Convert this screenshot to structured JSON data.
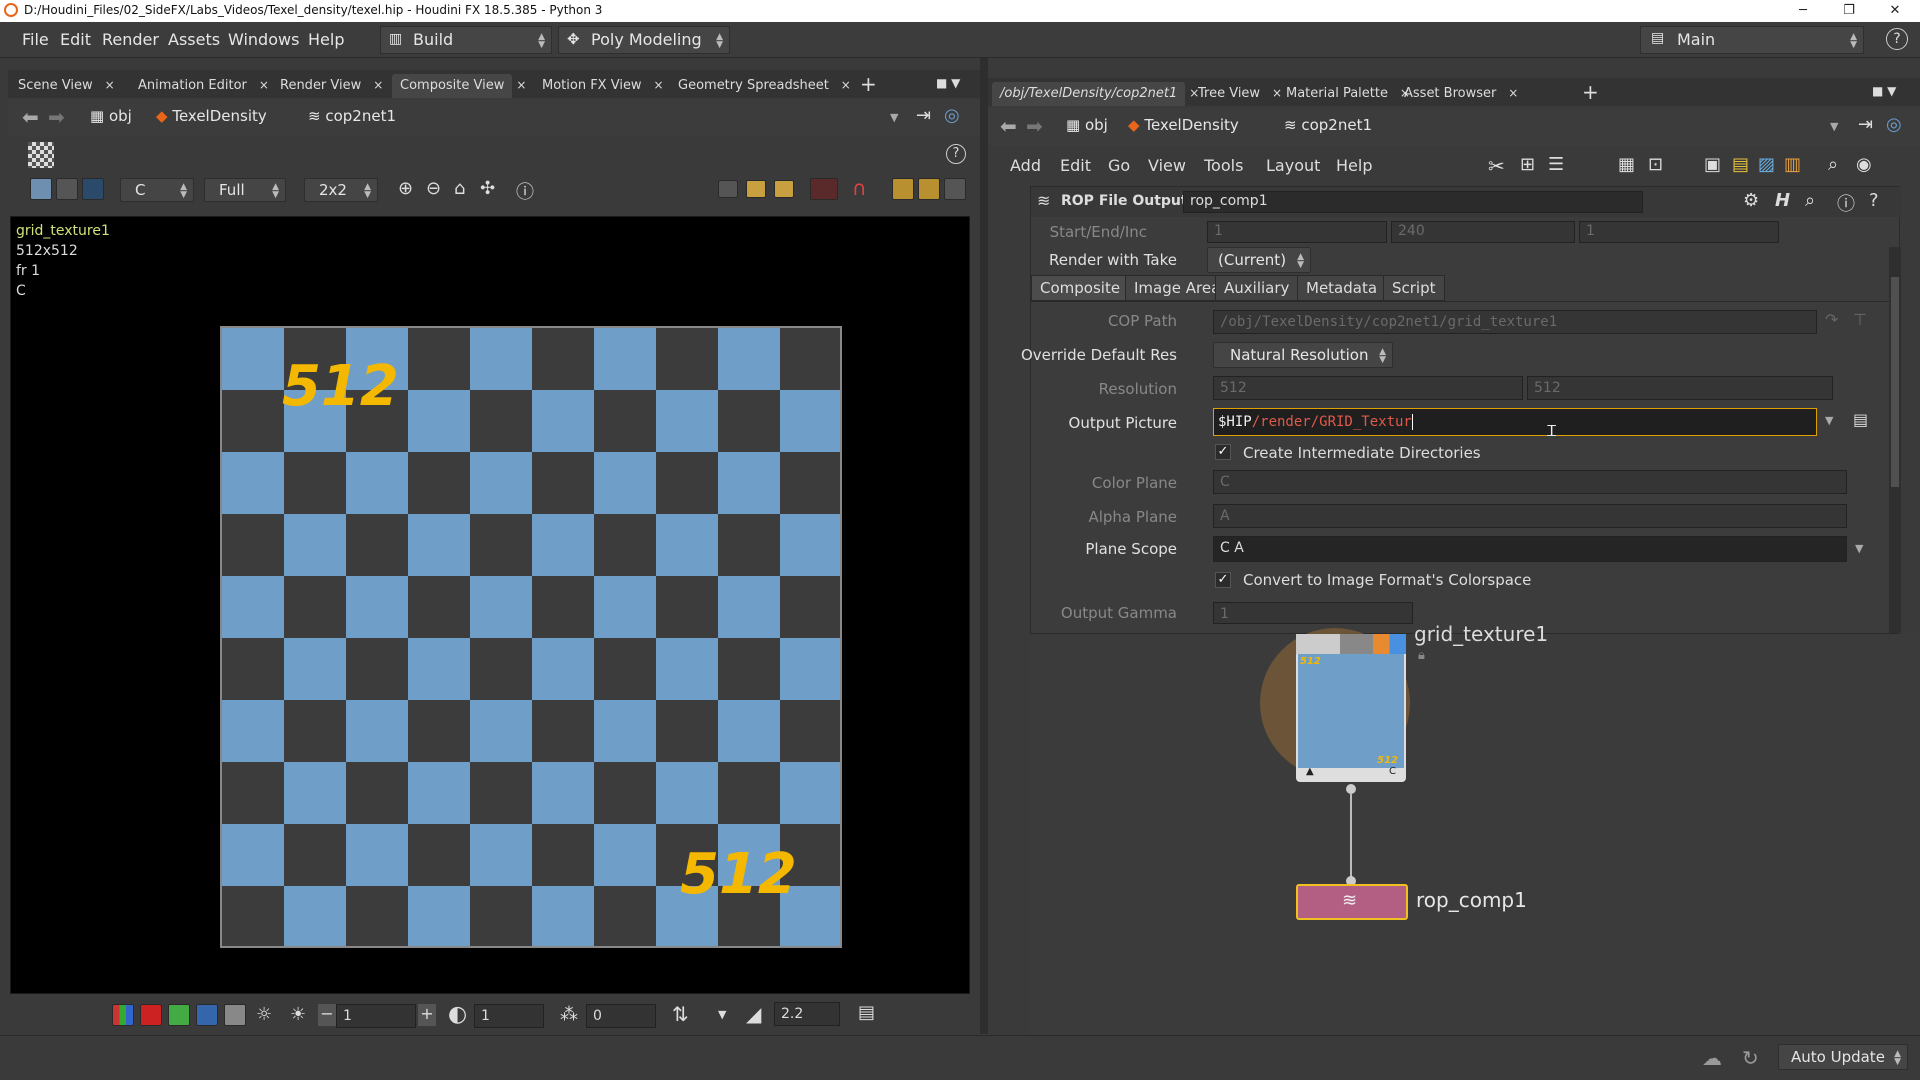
{
  "window": {
    "title": "D:/Houdini_Files/02_SideFX/Labs_Videos/Texel_density/texel.hip - Houdini FX 18.5.385 - Python 3",
    "minimize": "─",
    "maximize": "❐",
    "close": "✕"
  },
  "menubar": {
    "items": [
      "File",
      "Edit",
      "Render",
      "Assets",
      "Windows",
      "Help"
    ],
    "desktop": "Build",
    "shelf_set": "Poly Modeling",
    "workspace": "Main",
    "help_icon": "?"
  },
  "left_tabs": [
    "Scene View",
    "Animation Editor",
    "Render View",
    "Composite View",
    "Motion FX View",
    "Geometry Spreadsheet"
  ],
  "left_path": {
    "root": "obj",
    "node1": "TexelDensity",
    "node2": "cop2net1"
  },
  "viewer_toolbar": {
    "plane": "C",
    "resolution": "Full",
    "split": "2x2"
  },
  "viewport": {
    "node_name": "grid_texture1",
    "res": "512x512",
    "frame": "fr 1",
    "plane": "C",
    "label_top": "512",
    "label_bottom": "512",
    "colors": {
      "light": "#6f9fc8",
      "dark": "#3c3c3c"
    }
  },
  "viewer_bottom": {
    "exposure": "1",
    "gamma_val": "1",
    "offset": "0",
    "lut_gamma": "2.2"
  },
  "right_tabs": [
    "/obj/TexelDensity/cop2net1",
    "Tree View",
    "Material Palette",
    "Asset Browser"
  ],
  "right_path": {
    "root": "obj",
    "node1": "TexelDensity",
    "node2": "cop2net1"
  },
  "right_menu": [
    "Add",
    "Edit",
    "Go",
    "View",
    "Tools",
    "Layout",
    "Help"
  ],
  "params": {
    "node_type": "ROP File Output",
    "node_name": "rop_comp1",
    "start_end_inc_label": "Start/End/Inc",
    "start": "1",
    "end": "240",
    "inc": "1",
    "render_with_take_label": "Render with Take",
    "render_with_take": "(Current)",
    "tabs": [
      "Composite",
      "Image Area",
      "Auxiliary",
      "Metadata",
      "Script"
    ],
    "cop_path_label": "COP Path",
    "cop_path": "/obj/TexelDensity/cop2net1/grid_texture1",
    "override_res_label": "Override Default Res",
    "override_res": "Natural Resolution",
    "resolution_label": "Resolution",
    "res_x": "512",
    "res_y": "512",
    "output_picture_label": "Output Picture",
    "output_var": "$HIP",
    "output_rest": "/render/GRID_Textur",
    "create_dirs": "Create Intermediate Directories",
    "color_plane_label": "Color Plane",
    "color_plane": "C",
    "alpha_plane_label": "Alpha Plane",
    "alpha_plane": "A",
    "plane_scope_label": "Plane Scope",
    "plane_scope": "C A",
    "convert_colorspace": "Convert to Image Format's Colorspace",
    "output_gamma_label": "Output Gamma",
    "output_gamma": "1"
  },
  "network": {
    "node1": {
      "name": "grid_texture1",
      "thumb_label": "512",
      "flag_left": "▲",
      "flag_right": "C"
    },
    "node2": {
      "name": "rop_comp1"
    }
  },
  "status": {
    "auto_update": "Auto Update"
  }
}
